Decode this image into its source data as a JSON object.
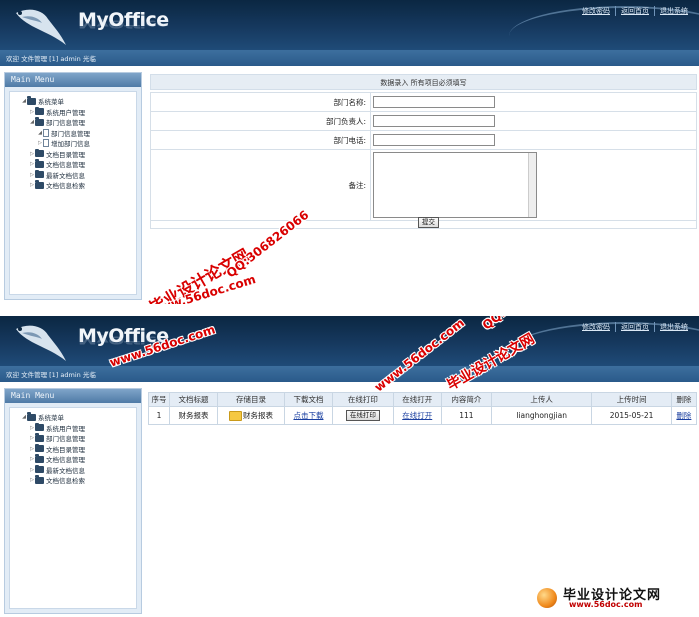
{
  "app": {
    "logo": "MyOffice"
  },
  "header_links": [
    "修改密码",
    "返回首页",
    "退出系统"
  ],
  "welcome_text": "欢迎 文件管理 [1] admin 光临",
  "sidebar": {
    "title": "Main Menu",
    "top_tree": [
      {
        "label": "系统菜单",
        "level": 0,
        "icon": "folder-icon"
      },
      {
        "label": "系统用户管理",
        "level": 1,
        "icon": "folder-icon"
      },
      {
        "label": "部门信息管理",
        "level": 1,
        "icon": "folder-icon"
      },
      {
        "label": "部门信息管理",
        "level": 2,
        "icon": "document-icon"
      },
      {
        "label": "增加部门信息",
        "level": 2,
        "icon": "document-icon"
      },
      {
        "label": "文档目录管理",
        "level": 1,
        "icon": "folder-icon"
      },
      {
        "label": "文档信息管理",
        "level": 1,
        "icon": "folder-icon"
      },
      {
        "label": "最新文档信息",
        "level": 1,
        "icon": "folder-icon"
      },
      {
        "label": "文档信息检索",
        "level": 1,
        "icon": "folder-icon"
      }
    ],
    "bottom_tree": [
      {
        "label": "系统菜单",
        "level": 0,
        "icon": "folder-icon"
      },
      {
        "label": "系统用户管理",
        "level": 1,
        "icon": "folder-icon"
      },
      {
        "label": "部门信息管理",
        "level": 1,
        "icon": "folder-icon"
      },
      {
        "label": "文档目录管理",
        "level": 1,
        "icon": "folder-icon"
      },
      {
        "label": "文档信息管理",
        "level": 1,
        "icon": "folder-icon"
      },
      {
        "label": "最新文档信息",
        "level": 1,
        "icon": "folder-icon"
      },
      {
        "label": "文档信息检索",
        "level": 1,
        "icon": "folder-icon"
      }
    ]
  },
  "form": {
    "title": "数据录入  所有项目必须填写",
    "fields": {
      "dept_name_label": "部门名称:",
      "dept_head_label": "部门负责人:",
      "dept_phone_label": "部门电话:",
      "remark_label": "备注:"
    },
    "submit_label": "提交"
  },
  "grid": {
    "headers": [
      "序号",
      "文档标题",
      "存储目录",
      "下载文档",
      "在线打印",
      "在线打开",
      "内容简介",
      "上传人",
      "上传时间",
      "删除"
    ],
    "rows": [
      {
        "no": "1",
        "title": "财务报表",
        "folder": "财务报表",
        "download": "点击下载",
        "print": "在线打印",
        "open": "在线打开",
        "summary": "111",
        "uploader": "lianghongjian",
        "time": "2015-05-21",
        "delete": "删除"
      }
    ]
  },
  "watermarks": {
    "site_cn": "毕业设计论文网",
    "qq": "QQ:306826066",
    "url": "www.56doc.com"
  },
  "footer_logo": {
    "name": "毕业设计论文网",
    "url": "www.56doc.com"
  },
  "colors": {
    "header_dark": "#0b2742",
    "welcome_bar": "#2a5a8a",
    "watermark": "#d90000"
  }
}
